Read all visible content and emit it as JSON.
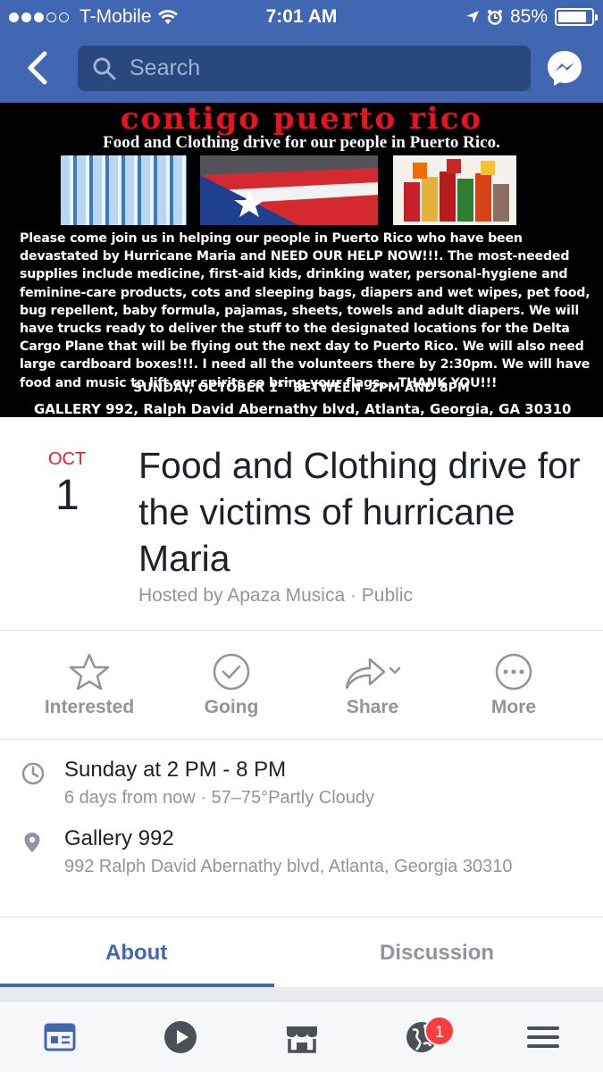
{
  "status_bar": {
    "carrier": "T-Mobile",
    "time": "7:01 AM",
    "battery": "85%",
    "battery_level": 0.85
  },
  "nav": {
    "search_placeholder": "Search"
  },
  "banner": {
    "title": "contigo puerto rico",
    "subtitle": "Food and Clothing drive for our people in Puerto Rico.",
    "body": "Please come join us in helping our people in Puerto Rico who have been devastated by Hurricane Maria and NEED OUR HELP NOW!!!. The most-needed supplies include medicine, first-aid kids, drinking water, personal-hygiene and feminine-care products, cots and sleeping bags, diapers and wet wipes,  pet food, bug repellent, baby formula, pajamas, sheets, towels and adult diapers. We will have trucks ready to deliver the stuff to the designated locations for the Delta Cargo Plane that will be flying out the next day to Puerto Rico.  We will also need large cardboard boxes!!!. I need all the volunteers there by 2:30pm. We will have food and music to lift our spirits so bring your flags... THANK YOU!!!",
    "date_line_prefix": "SUNDAY, OCTOBER 1",
    "date_line_sup": "ST",
    "date_line_suffix": " BETWEEN  2PM AND 8PM",
    "address_line": "GALLERY 992, Ralph David Abernathy blvd, Atlanta, Georgia, GA 30310"
  },
  "event": {
    "month": "OCT",
    "day": "1",
    "title": "Food and Clothing drive for the victims of hurricane Maria",
    "host": "Hosted by Apaza Musica · Public"
  },
  "actions": [
    {
      "label": "Interested",
      "icon": "star-icon"
    },
    {
      "label": "Going",
      "icon": "check-circle-icon"
    },
    {
      "label": "Share",
      "icon": "share-arrow-icon"
    },
    {
      "label": "More",
      "icon": "more-dots-icon"
    }
  ],
  "info": {
    "time_main": "Sunday at 2 PM - 8 PM",
    "time_sub": "6 days from now · 57–75°Partly Cloudy",
    "place_main": "Gallery 992",
    "place_sub": "992 Ralph David Abernathy blvd, Atlanta, Georgia 30310"
  },
  "tabs": [
    {
      "label": "About",
      "active": true
    },
    {
      "label": "Discussion",
      "active": false
    }
  ],
  "bottom_nav": {
    "notification_count": "1"
  },
  "colors": {
    "brand": "#4267b2",
    "accent_red": "#e2232a",
    "text_primary": "#1d2129",
    "text_secondary": "#90949c"
  }
}
